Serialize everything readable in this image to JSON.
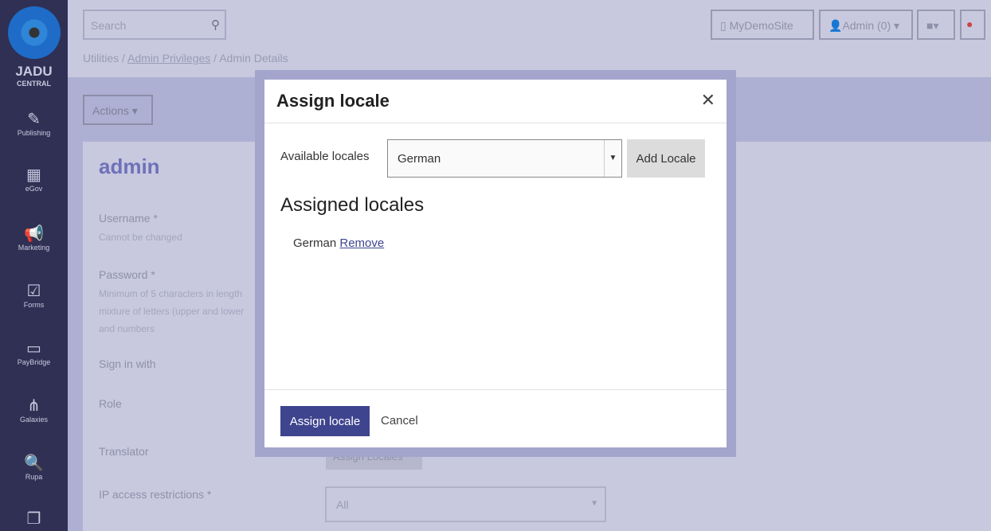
{
  "sidebar": {
    "brand_top": "JADU",
    "brand_bottom": "CENTRAL",
    "items": [
      {
        "label": "Publishing",
        "icon": "pencil-icon"
      },
      {
        "label": "eGov",
        "icon": "building-icon"
      },
      {
        "label": "Marketing",
        "icon": "megaphone-icon"
      },
      {
        "label": "Forms",
        "icon": "clipboard-icon"
      },
      {
        "label": "PayBridge",
        "icon": "card-icon"
      },
      {
        "label": "Galaxies",
        "icon": "sitemap-icon"
      },
      {
        "label": "Rupa",
        "icon": "search-icon"
      },
      {
        "label": "",
        "icon": "files-icon"
      }
    ]
  },
  "header": {
    "search_placeholder": "Search",
    "crumb_1": "Utilities",
    "crumb_2": "Admin Privileges",
    "crumb_3": "Admin Details",
    "site": "MyDemoSite",
    "user": "Admin (0)"
  },
  "page": {
    "actions": "Actions",
    "title": "admin",
    "username": "Username *",
    "username_hint": "Cannot be changed",
    "password": "Password *",
    "password_hint_1": "Minimum of 5 characters in length",
    "password_hint_2": "mixture of letters (upper and lower",
    "password_hint_3": "and numbers",
    "sign_in": "Sign in with",
    "role": "Role",
    "translator": "Translator",
    "assign_locales": "Assign Locales",
    "ip": "IP access restrictions *",
    "ip_value": "All"
  },
  "modal": {
    "title": "Assign locale",
    "available_label": "Available locales",
    "selected": "German",
    "add": "Add Locale",
    "assigned_heading": "Assigned locales",
    "assigned": [
      {
        "name": "German",
        "action": "Remove"
      }
    ],
    "submit": "Assign locale",
    "cancel": "Cancel"
  },
  "colors": {
    "primary": "#3f448e",
    "sidebar": "#2f3054",
    "overlay": "#a3a5cc"
  }
}
